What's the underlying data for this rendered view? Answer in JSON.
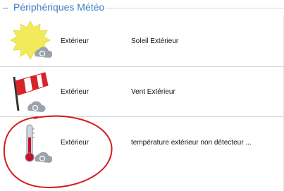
{
  "section": {
    "title": "Périphériques Météo",
    "toggle_symbol": "–"
  },
  "devices": [
    {
      "location": "Extérieur",
      "name": "Soleil Extérieur",
      "icon": "sun-icon"
    },
    {
      "location": "Extérieur",
      "name": "Vent Extérieur",
      "icon": "windsock-icon"
    },
    {
      "location": "Extérieur",
      "name": "température extérieur non détecteur ...",
      "icon": "thermometer-icon"
    }
  ],
  "colors": {
    "accent": "#3b7cc6",
    "sun": "#f2ea5a",
    "wind": "#d8232a",
    "annotation": "#d41c1c"
  }
}
